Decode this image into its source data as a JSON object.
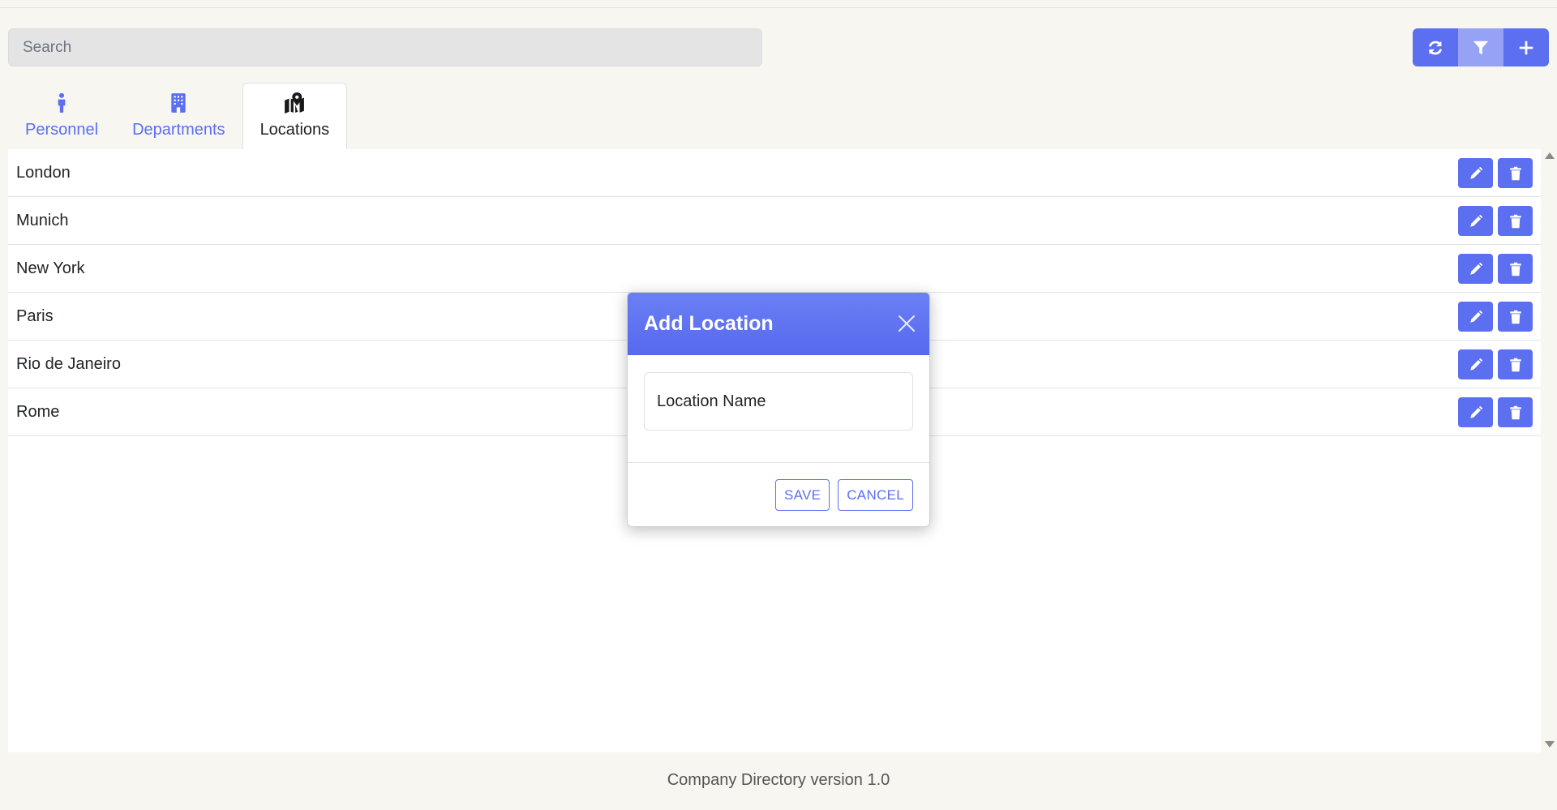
{
  "search": {
    "placeholder": "Search"
  },
  "toolbar": {
    "buttons": [
      {
        "name": "refresh",
        "icon": "refresh-icon"
      },
      {
        "name": "filter",
        "icon": "filter-icon"
      },
      {
        "name": "add",
        "icon": "plus-icon"
      }
    ]
  },
  "tabs": [
    {
      "label": "Personnel",
      "icon": "person-icon",
      "active": false
    },
    {
      "label": "Departments",
      "icon": "building-icon",
      "active": false
    },
    {
      "label": "Locations",
      "icon": "map-location-icon",
      "active": true
    }
  ],
  "locations": [
    {
      "name": "London"
    },
    {
      "name": "Munich"
    },
    {
      "name": "New York"
    },
    {
      "name": "Paris"
    },
    {
      "name": "Rio de Janeiro"
    },
    {
      "name": "Rome"
    }
  ],
  "row_actions": {
    "edit_icon": "pencil-icon",
    "delete_icon": "trash-icon"
  },
  "modal": {
    "title": "Add Location",
    "input_placeholder": "Location Name",
    "input_value": "",
    "save_label": "SAVE",
    "cancel_label": "CANCEL"
  },
  "footer": {
    "text": "Company Directory version 1.0"
  },
  "colors": {
    "accent": "#5b6ff0",
    "accent_light": "#96a2f5",
    "background": "#f8f6f1"
  }
}
